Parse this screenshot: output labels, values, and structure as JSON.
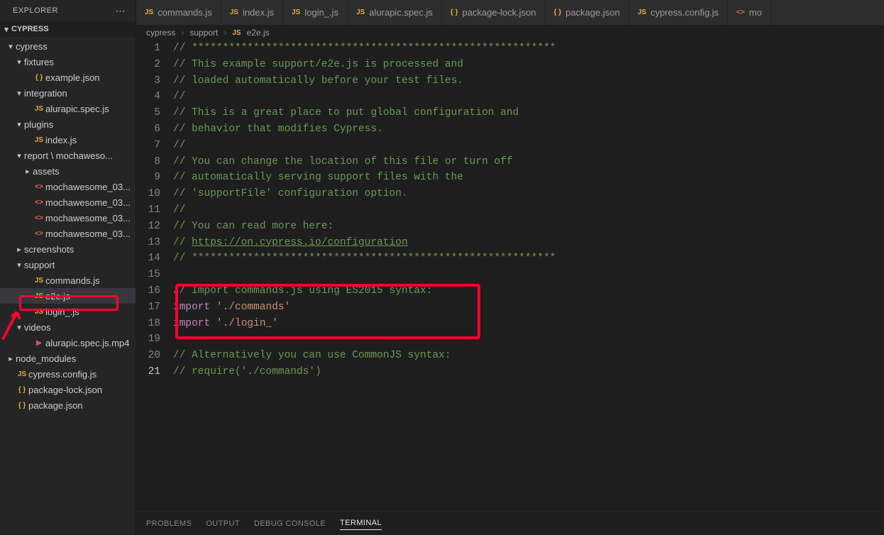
{
  "explorer": {
    "title": "EXPLORER",
    "project": "CYPRESS",
    "tree": [
      {
        "kind": "folder",
        "open": true,
        "depth": 0,
        "name": "cypress"
      },
      {
        "kind": "folder",
        "open": true,
        "depth": 1,
        "name": "fixtures"
      },
      {
        "kind": "file",
        "icon": "json",
        "iconText": "{ }",
        "depth": 2,
        "name": "example.json"
      },
      {
        "kind": "folder",
        "open": true,
        "depth": 1,
        "name": "integration"
      },
      {
        "kind": "file",
        "icon": "js",
        "iconText": "JS",
        "depth": 2,
        "name": "alurapic.spec.js"
      },
      {
        "kind": "folder",
        "open": true,
        "depth": 1,
        "name": "plugins"
      },
      {
        "kind": "file",
        "icon": "js",
        "iconText": "JS",
        "depth": 2,
        "name": "index.js"
      },
      {
        "kind": "folder",
        "open": true,
        "depth": 1,
        "name": "report \\ mochaweso..."
      },
      {
        "kind": "folder",
        "open": false,
        "depth": 2,
        "name": "assets"
      },
      {
        "kind": "file",
        "icon": "html",
        "iconText": "<>",
        "depth": 2,
        "name": "mochawesome_03..."
      },
      {
        "kind": "file",
        "icon": "html",
        "iconText": "<>",
        "depth": 2,
        "name": "mochawesome_03..."
      },
      {
        "kind": "file",
        "icon": "html",
        "iconText": "<>",
        "depth": 2,
        "name": "mochawesome_03..."
      },
      {
        "kind": "file",
        "icon": "html",
        "iconText": "<>",
        "depth": 2,
        "name": "mochawesome_03..."
      },
      {
        "kind": "folder",
        "open": false,
        "depth": 1,
        "name": "screenshots"
      },
      {
        "kind": "folder",
        "open": true,
        "depth": 1,
        "name": "support"
      },
      {
        "kind": "file",
        "icon": "js",
        "iconText": "JS",
        "depth": 2,
        "name": "commands.js"
      },
      {
        "kind": "file",
        "icon": "js",
        "iconText": "JS",
        "depth": 2,
        "name": "e2e.js",
        "selected": true
      },
      {
        "kind": "file",
        "icon": "js",
        "iconText": "JS",
        "depth": 2,
        "name": "login_.js"
      },
      {
        "kind": "folder",
        "open": true,
        "depth": 1,
        "name": "videos"
      },
      {
        "kind": "file",
        "icon": "mp4",
        "iconText": "▶",
        "depth": 2,
        "name": "alurapic.spec.js.mp4"
      },
      {
        "kind": "folder",
        "open": false,
        "depth": 0,
        "name": "node_modules"
      },
      {
        "kind": "file",
        "icon": "js",
        "iconText": "JS",
        "depth": 0,
        "name": "cypress.config.js"
      },
      {
        "kind": "file",
        "icon": "json",
        "iconText": "{ }",
        "depth": 0,
        "name": "package-lock.json"
      },
      {
        "kind": "file",
        "icon": "json",
        "iconText": "{ }",
        "depth": 0,
        "name": "package.json"
      }
    ]
  },
  "tabs": [
    {
      "icon": "js",
      "iconText": "JS",
      "label": "commands.js"
    },
    {
      "icon": "js",
      "iconText": "JS",
      "label": "index.js"
    },
    {
      "icon": "js",
      "iconText": "JS",
      "label": "login_.js"
    },
    {
      "icon": "js",
      "iconText": "JS",
      "label": "alurapic.spec.js"
    },
    {
      "icon": "json",
      "iconText": "{ }",
      "label": "package-lock.json"
    },
    {
      "icon": "json",
      "iconText": "{ }",
      "label": "package.json"
    },
    {
      "icon": "js",
      "iconText": "JS",
      "label": "cypress.config.js"
    },
    {
      "icon": "html",
      "iconText": "<>",
      "label": "mo"
    }
  ],
  "breadcrumb": {
    "parts": [
      "cypress",
      "support"
    ],
    "fileIcon": "JS",
    "file": "e2e.js"
  },
  "code": {
    "currentLine": 21,
    "lines": [
      {
        "n": 1,
        "t": [
          [
            "cm",
            "// ***********************************************************"
          ]
        ]
      },
      {
        "n": 2,
        "t": [
          [
            "cm",
            "// This example support/e2e.js is processed and"
          ]
        ]
      },
      {
        "n": 3,
        "t": [
          [
            "cm",
            "// loaded automatically before your test files."
          ]
        ]
      },
      {
        "n": 4,
        "t": [
          [
            "cm",
            "//"
          ]
        ]
      },
      {
        "n": 5,
        "t": [
          [
            "cm",
            "// This is a great place to put global configuration and"
          ]
        ]
      },
      {
        "n": 6,
        "t": [
          [
            "cm",
            "// behavior that modifies Cypress."
          ]
        ]
      },
      {
        "n": 7,
        "t": [
          [
            "cm",
            "//"
          ]
        ]
      },
      {
        "n": 8,
        "t": [
          [
            "cm",
            "// You can change the location of this file or turn off"
          ]
        ]
      },
      {
        "n": 9,
        "t": [
          [
            "cm",
            "// automatically serving support files with the"
          ]
        ]
      },
      {
        "n": 10,
        "t": [
          [
            "cm",
            "// 'supportFile' configuration option."
          ]
        ]
      },
      {
        "n": 11,
        "t": [
          [
            "cm",
            "//"
          ]
        ]
      },
      {
        "n": 12,
        "t": [
          [
            "cm",
            "// You can read more here:"
          ]
        ]
      },
      {
        "n": 13,
        "t": [
          [
            "cm",
            "// "
          ],
          [
            "cmul",
            "https://on.cypress.io/configuration"
          ]
        ]
      },
      {
        "n": 14,
        "t": [
          [
            "cm",
            "// ***********************************************************"
          ]
        ]
      },
      {
        "n": 15,
        "t": []
      },
      {
        "n": 16,
        "t": [
          [
            "cm",
            "// Import commands.js using ES2015 syntax:"
          ]
        ]
      },
      {
        "n": 17,
        "t": [
          [
            "kw",
            "import"
          ],
          [
            "pl",
            " "
          ],
          [
            "st",
            "'./commands'"
          ]
        ]
      },
      {
        "n": 18,
        "t": [
          [
            "kw",
            "import"
          ],
          [
            "pl",
            " "
          ],
          [
            "st",
            "'./login_'"
          ]
        ]
      },
      {
        "n": 19,
        "t": []
      },
      {
        "n": 20,
        "t": [
          [
            "cm",
            "// Alternatively you can use CommonJS syntax:"
          ]
        ]
      },
      {
        "n": 21,
        "t": [
          [
            "cm",
            "// require('./commands')"
          ]
        ]
      }
    ]
  },
  "panel": {
    "tabs": [
      "PROBLEMS",
      "OUTPUT",
      "DEBUG CONSOLE",
      "TERMINAL"
    ],
    "active": "TERMINAL"
  }
}
